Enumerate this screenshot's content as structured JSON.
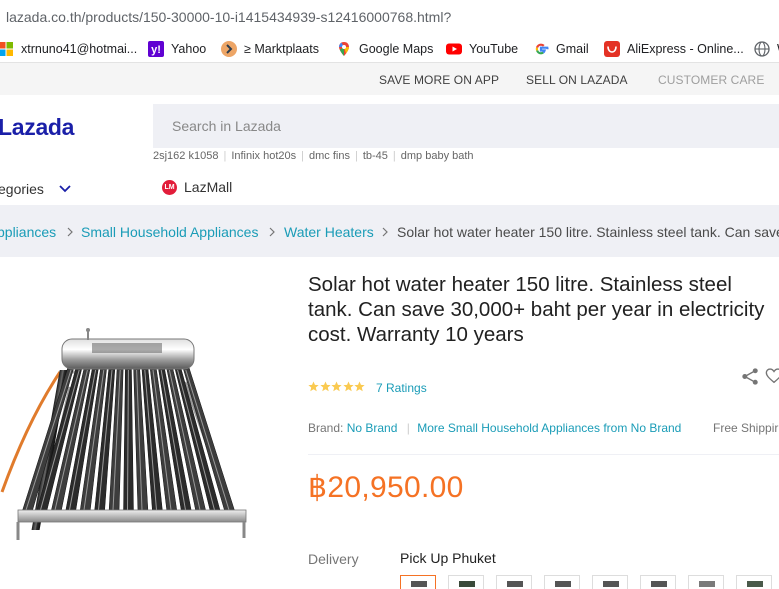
{
  "browser": {
    "url": "lazada.co.th/products/150-30000-10-i1415434939-s12416000768.html?",
    "bookmarks": [
      {
        "label": "xtrnuno41@hotmai...",
        "icon": "microsoft-icon"
      },
      {
        "label": "Yahoo",
        "icon": "yahoo-icon"
      },
      {
        "label": "≥ Marktplaats",
        "icon": "marktplaats-icon"
      },
      {
        "label": "Google Maps",
        "icon": "google-maps-icon"
      },
      {
        "label": "YouTube",
        "icon": "youtube-icon"
      },
      {
        "label": "Gmail",
        "icon": "google-icon"
      },
      {
        "label": "AliExpress - Online...",
        "icon": "aliexpress-icon"
      },
      {
        "label": "W",
        "icon": "globe-icon"
      }
    ]
  },
  "toplinks": {
    "save_more": "SAVE MORE ON APP",
    "sell": "SELL ON LAZADA",
    "care": "CUSTOMER CARE"
  },
  "header": {
    "logo": "Lazada",
    "search_placeholder": "Search in Lazada",
    "suggestions": [
      "2sj162 k1058",
      "Infinix hot20s",
      "dmc fins",
      "tb-45",
      "dmp baby bath"
    ],
    "categories_label": "egories",
    "lazmall_label": "LazMall",
    "lazmall_badge": "LM"
  },
  "breadcrumb": [
    {
      "label": "ppliances",
      "type": "link"
    },
    {
      "label": "Small Household Appliances",
      "type": "link"
    },
    {
      "label": "Water Heaters",
      "type": "link"
    },
    {
      "label": "Solar hot water heater 150 litre. Stainless steel tank. Can save",
      "type": "current"
    }
  ],
  "product": {
    "title": "Solar hot water heater 150 litre. Stainless steel tank. Can save 30,000+ baht per year in electricity cost. Warranty 10 years",
    "rating": 5,
    "ratings_text": "7 Ratings",
    "brand_label": "Brand:",
    "brand_value": "No Brand",
    "more_link": "More Small Household Appliances from No Brand",
    "free_shipping": "Free Shippir",
    "price": "฿20,950.00",
    "delivery_label": "Delivery",
    "delivery_value": "Pick Up Phuket"
  },
  "colors": {
    "accent": "#f57224",
    "link": "#1a9cb7",
    "brand": "#1a1fa8",
    "star": "#faca51"
  }
}
